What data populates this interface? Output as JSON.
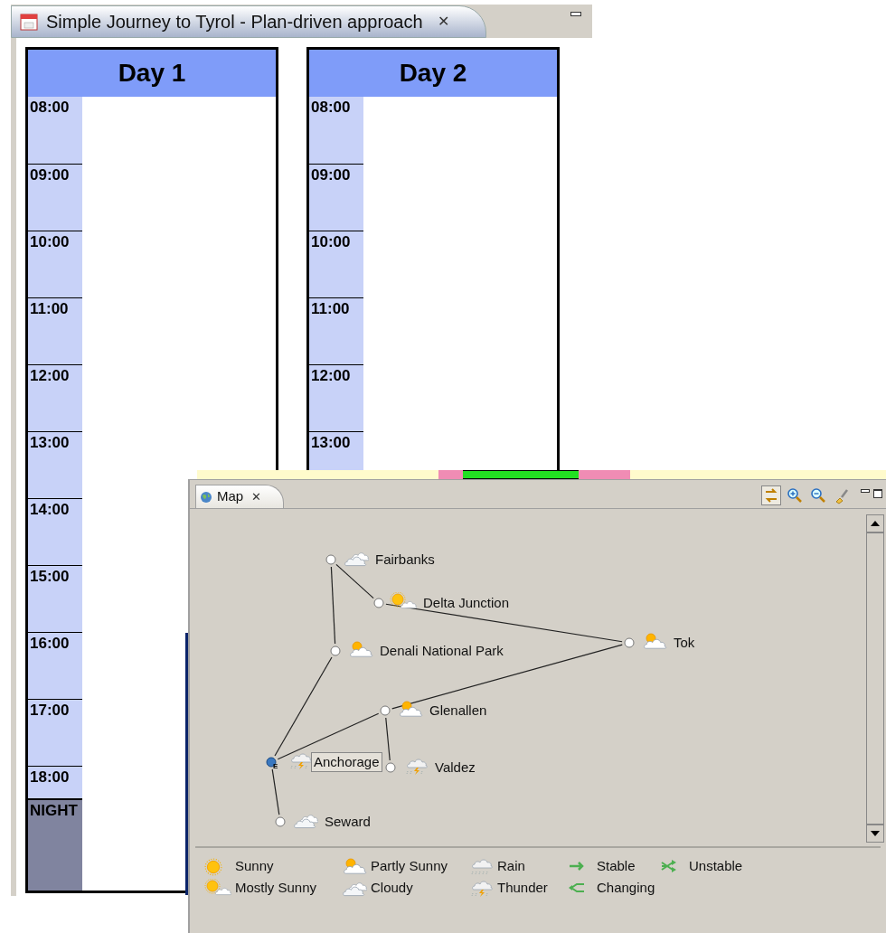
{
  "editor": {
    "title": "Simple Journey to Tyrol - Plan-driven approach",
    "close": "✕",
    "days": [
      {
        "title": "Day 1",
        "hours": [
          "08:00",
          "09:00",
          "10:00",
          "11:00",
          "12:00",
          "13:00",
          "14:00",
          "15:00",
          "16:00",
          "17:00",
          "18:00"
        ],
        "night": "NIGHT"
      },
      {
        "title": "Day 2",
        "hours": [
          "08:00",
          "09:00",
          "10:00",
          "11:00",
          "12:00",
          "13:00"
        ]
      }
    ]
  },
  "map_view": {
    "title": "Map",
    "close": "✕",
    "toolbar": [
      {
        "kind": "layout",
        "pressed": true
      },
      {
        "kind": "zoom_in",
        "pressed": false
      },
      {
        "kind": "zoom_out",
        "pressed": false
      },
      {
        "kind": "brush",
        "pressed": false
      }
    ],
    "places": [
      {
        "name": "Fairbanks",
        "kind": "cloudy",
        "selected": false
      },
      {
        "name": "Delta Junction",
        "kind": "mostly_sunny",
        "selected": false
      },
      {
        "name": "Denali National Park",
        "kind": "partly_sunny",
        "selected": false
      },
      {
        "name": "Tok",
        "kind": "partly_sunny",
        "selected": false
      },
      {
        "name": "Glenallen",
        "kind": "partly_sunny",
        "selected": false
      },
      {
        "name": "Anchorage",
        "kind": "thunder",
        "selected": true,
        "badge": "E"
      },
      {
        "name": "Valdez",
        "kind": "thunder",
        "selected": false
      },
      {
        "name": "Seward",
        "kind": "cloudy",
        "selected": false
      }
    ],
    "legend": [
      {
        "kind": "sunny",
        "label": "Sunny"
      },
      {
        "kind": "mostly_sunny",
        "label": "Mostly Sunny"
      },
      {
        "kind": "partly_sunny",
        "label": "Partly Sunny"
      },
      {
        "kind": "cloudy",
        "label": "Cloudy"
      },
      {
        "kind": "rain",
        "label": "Rain"
      },
      {
        "kind": "thunder",
        "label": "Thunder"
      },
      {
        "kind": "stable",
        "label": "Stable"
      },
      {
        "kind": "changing",
        "label": "Changing"
      },
      {
        "kind": "unstable",
        "label": "Unstable"
      }
    ]
  }
}
